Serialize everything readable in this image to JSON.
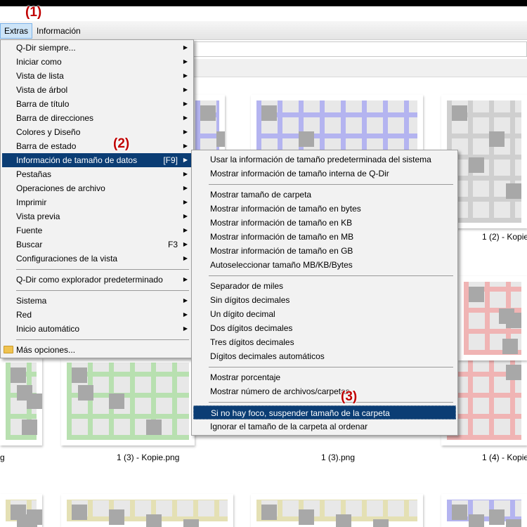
{
  "annotations": {
    "a1": "(1)",
    "a2": "(2)",
    "a3": "(3)"
  },
  "menubar": {
    "extras": "Extras",
    "informacion": "Información"
  },
  "thumbnails": {
    "labels": {
      "l1": "1 (2) - Kopie",
      "l2": "g",
      "l3": "1 (3) - Kopie.png",
      "l4": "1 (3).png",
      "l5": "1 (4) - Kopie"
    },
    "colors": {
      "blue": "#b4b4f0",
      "gray": "#cfcfcf",
      "green": "#b8e0b0",
      "pink": "#f0b4b4",
      "olive": "#e4e0b4",
      "cell": "#a8a8a8"
    }
  },
  "extras_menu": {
    "items": [
      {
        "label": "Q-Dir siempre...",
        "arrow": true
      },
      {
        "label": "Iniciar como",
        "arrow": true
      },
      {
        "label": "Vista de lista",
        "arrow": true
      },
      {
        "label": "Vista de árbol",
        "arrow": true
      },
      {
        "label": "Barra de título",
        "arrow": true
      },
      {
        "label": "Barra de direcciones",
        "arrow": true
      },
      {
        "label": "Colores y Diseño",
        "arrow": true
      },
      {
        "label": "Barra de estado",
        "arrow": true
      },
      {
        "label": "Información de tamaño de datos",
        "shortcut": "[F9]",
        "arrow": true
      },
      {
        "label": "Pestañas",
        "arrow": true
      },
      {
        "label": "Operaciones de archivo",
        "arrow": true
      },
      {
        "label": "Imprimir",
        "arrow": true
      },
      {
        "label": "Vista previa",
        "arrow": true
      },
      {
        "label": "Fuente",
        "arrow": true
      },
      {
        "label": "Buscar",
        "shortcut": "F3",
        "arrow": true
      },
      {
        "label": "Configuraciones de la vista",
        "arrow": true
      },
      {
        "label": "Q-Dir como explorador predeterminado",
        "arrow": true
      },
      {
        "label": "Sistema",
        "arrow": true
      },
      {
        "label": "Red",
        "arrow": true
      },
      {
        "label": "Inicio automático",
        "arrow": true
      },
      {
        "label": "Más opciones...",
        "icon": "folder-icon"
      }
    ]
  },
  "size_submenu": {
    "items": [
      "Usar la información de tamaño predeterminada del sistema",
      "Mostrar información de tamaño interna de Q-Dir",
      "Mostrar tamaño de carpeta",
      "Mostrar información de tamaño en bytes",
      "Mostrar información de tamaño en KB",
      "Mostrar información de tamaño en MB",
      "Mostrar información de tamaño en GB",
      "Autoseleccionar tamaño MB/KB/Bytes",
      "Separador de miles",
      "Sin dígitos decimales",
      "Un dígito decimal",
      "Dos dígitos decimales",
      "Tres dígitos decimales",
      "Dígitos decimales automáticos",
      "Mostrar porcentaje",
      "Mostrar número de archivos/carpetas",
      "Si no hay foco, suspender tamaño de la carpeta",
      "Ignorar el tamaño de la carpeta al ordenar"
    ]
  }
}
